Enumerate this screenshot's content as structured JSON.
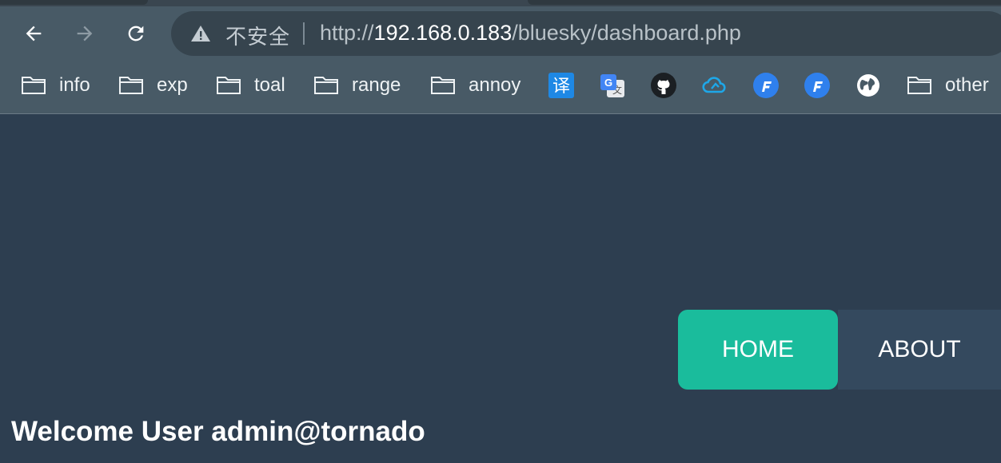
{
  "browser": {
    "security_label": "不安全",
    "url": {
      "scheme": "http://",
      "host": "192.168.0.183",
      "path": "/bluesky/dashboard.php"
    },
    "nav": {
      "back_icon": "arrow-left-icon",
      "forward_icon": "arrow-right-icon",
      "reload_icon": "reload-icon"
    },
    "bookmarks": [
      {
        "label": "info",
        "icon": "folder-icon"
      },
      {
        "label": "exp",
        "icon": "folder-icon"
      },
      {
        "label": "toal",
        "icon": "folder-icon"
      },
      {
        "label": "range",
        "icon": "folder-icon"
      },
      {
        "label": "annoy",
        "icon": "folder-icon"
      },
      {
        "icon": "translate-icon",
        "glyph": "译",
        "color": "#1e88e5"
      },
      {
        "icon": "google-translate-icon",
        "glyph": "G",
        "color": "#4285f4"
      },
      {
        "icon": "github-icon"
      },
      {
        "icon": "cloud-icon",
        "color": "#1ea7e8"
      },
      {
        "icon": "fofa-icon",
        "glyph": "F",
        "color": "#2f80ed"
      },
      {
        "icon": "fofa-icon-2",
        "glyph": "F",
        "color": "#2f80ed"
      },
      {
        "icon": "globe-icon"
      },
      {
        "label": "other",
        "icon": "folder-icon"
      }
    ]
  },
  "page": {
    "menu": {
      "home": "HOME",
      "about": "ABOUT"
    },
    "welcome": "Welcome User admin@tornado"
  },
  "colors": {
    "page_bg": "#2d3e50",
    "accent": "#1abc9c",
    "menu_bg": "#34495e",
    "toolbar_bg": "#485a66"
  }
}
